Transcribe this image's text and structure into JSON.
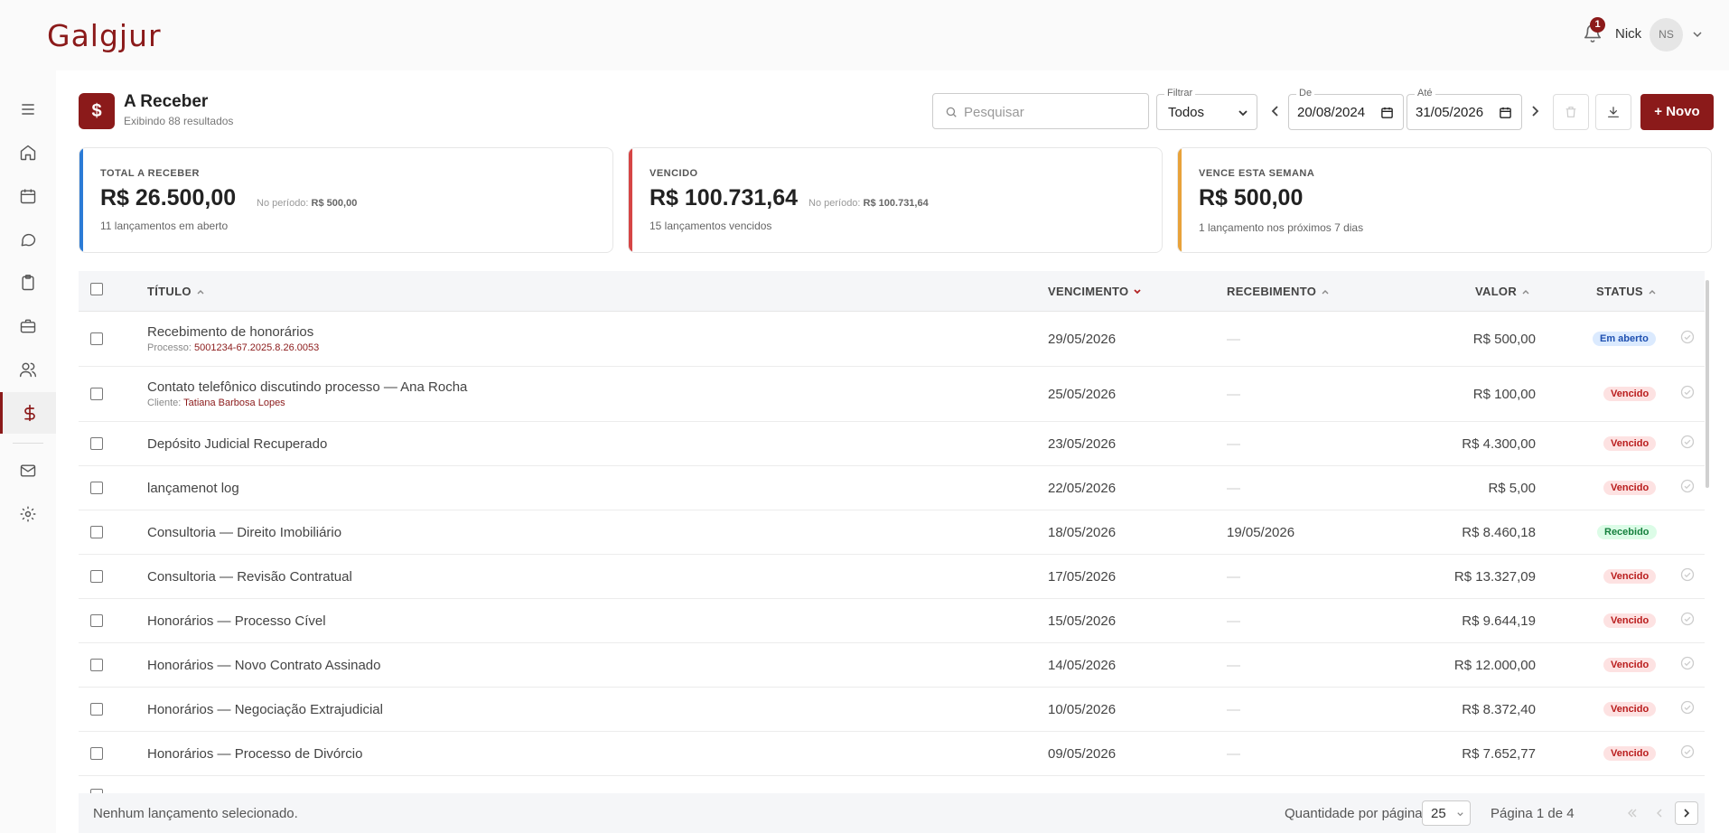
{
  "app": {
    "logo": "Galgjur"
  },
  "header": {
    "notifications": "1",
    "user_name": "Nick",
    "avatar_initials": "NS"
  },
  "sidebar": {
    "items": [
      {
        "icon": "menu-icon"
      },
      {
        "icon": "home-icon"
      },
      {
        "icon": "calendar-icon"
      },
      {
        "icon": "chat-icon"
      },
      {
        "icon": "clipboard-icon"
      },
      {
        "icon": "briefcase-icon"
      },
      {
        "icon": "users-icon"
      },
      {
        "icon": "dollar-icon",
        "active": true
      },
      {
        "icon": "mail-icon"
      },
      {
        "icon": "gear-icon"
      }
    ]
  },
  "page": {
    "icon": "$",
    "title": "A Receber",
    "subtitle": "Exibindo 88 resultados"
  },
  "toolbar": {
    "search_placeholder": "Pesquisar",
    "filter_label": "Filtrar",
    "filter_value": "Todos",
    "from_label": "De",
    "from_value": "20/08/2024",
    "to_label": "Até",
    "to_value": "31/05/2026",
    "new_label": "+ Novo"
  },
  "cards": [
    {
      "label": "TOTAL A RECEBER",
      "amount": "R$ 26.500,00",
      "period_label": "No período:",
      "period_value": "R$ 500,00",
      "note": "11 lançamentos em aberto",
      "color": "#2b7bd6"
    },
    {
      "label": "VENCIDO",
      "amount": "R$ 100.731,64",
      "period_label": "No período:",
      "period_value": "R$ 100.731,64",
      "note": "15 lançamentos vencidos",
      "color": "#d64545"
    },
    {
      "label": "VENCE ESTA SEMANA",
      "amount": "R$ 500,00",
      "note": "1 lançamento nos próximos 7 dias",
      "color": "#e8a23a"
    }
  ],
  "table": {
    "headers": {
      "title": "TÍTULO",
      "due": "VENCIMENTO",
      "received": "RECEBIMENTO",
      "value": "VALOR",
      "status": "STATUS"
    },
    "rows": [
      {
        "title": "Recebimento de honorários",
        "sub_label": "Processo:",
        "sub_value": "5001234-67.2025.8.26.0053",
        "due": "29/05/2026",
        "received": "—",
        "value": "R$ 500,00",
        "status": "Em aberto",
        "kind": "open"
      },
      {
        "title": "Contato telefônico discutindo processo — Ana Rocha",
        "sub_label": "Cliente:",
        "sub_value": "Tatiana Barbosa Lopes",
        "due": "25/05/2026",
        "received": "—",
        "value": "R$ 100,00",
        "status": "Vencido",
        "kind": "late"
      },
      {
        "title": "Depósito Judicial Recuperado",
        "due": "23/05/2026",
        "received": "—",
        "value": "R$ 4.300,00",
        "status": "Vencido",
        "kind": "late"
      },
      {
        "title": "lançamenot log",
        "due": "22/05/2026",
        "received": "—",
        "value": "R$ 5,00",
        "status": "Vencido",
        "kind": "late"
      },
      {
        "title": "Consultoria — Direito Imobiliário",
        "due": "18/05/2026",
        "received": "19/05/2026",
        "value": "R$ 8.460,18",
        "status": "Recebido",
        "kind": "paid"
      },
      {
        "title": "Consultoria — Revisão Contratual",
        "due": "17/05/2026",
        "received": "—",
        "value": "R$ 13.327,09",
        "status": "Vencido",
        "kind": "late"
      },
      {
        "title": "Honorários — Processo Cível",
        "due": "15/05/2026",
        "received": "—",
        "value": "R$ 9.644,19",
        "status": "Vencido",
        "kind": "late"
      },
      {
        "title": "Honorários — Novo Contrato Assinado",
        "due": "14/05/2026",
        "received": "—",
        "value": "R$ 12.000,00",
        "status": "Vencido",
        "kind": "late"
      },
      {
        "title": "Honorários — Negociação Extrajudicial",
        "due": "10/05/2026",
        "received": "—",
        "value": "R$ 8.372,40",
        "status": "Vencido",
        "kind": "late"
      },
      {
        "title": "Honorários — Processo de Divórcio",
        "due": "09/05/2026",
        "received": "—",
        "value": "R$ 7.652,77",
        "status": "Vencido",
        "kind": "late"
      }
    ]
  },
  "footer": {
    "selection_text": "Nenhum lançamento selecionado.",
    "per_page_label": "Quantidade por página:",
    "per_page_value": "25",
    "page_label": "Página 1 de 4"
  }
}
